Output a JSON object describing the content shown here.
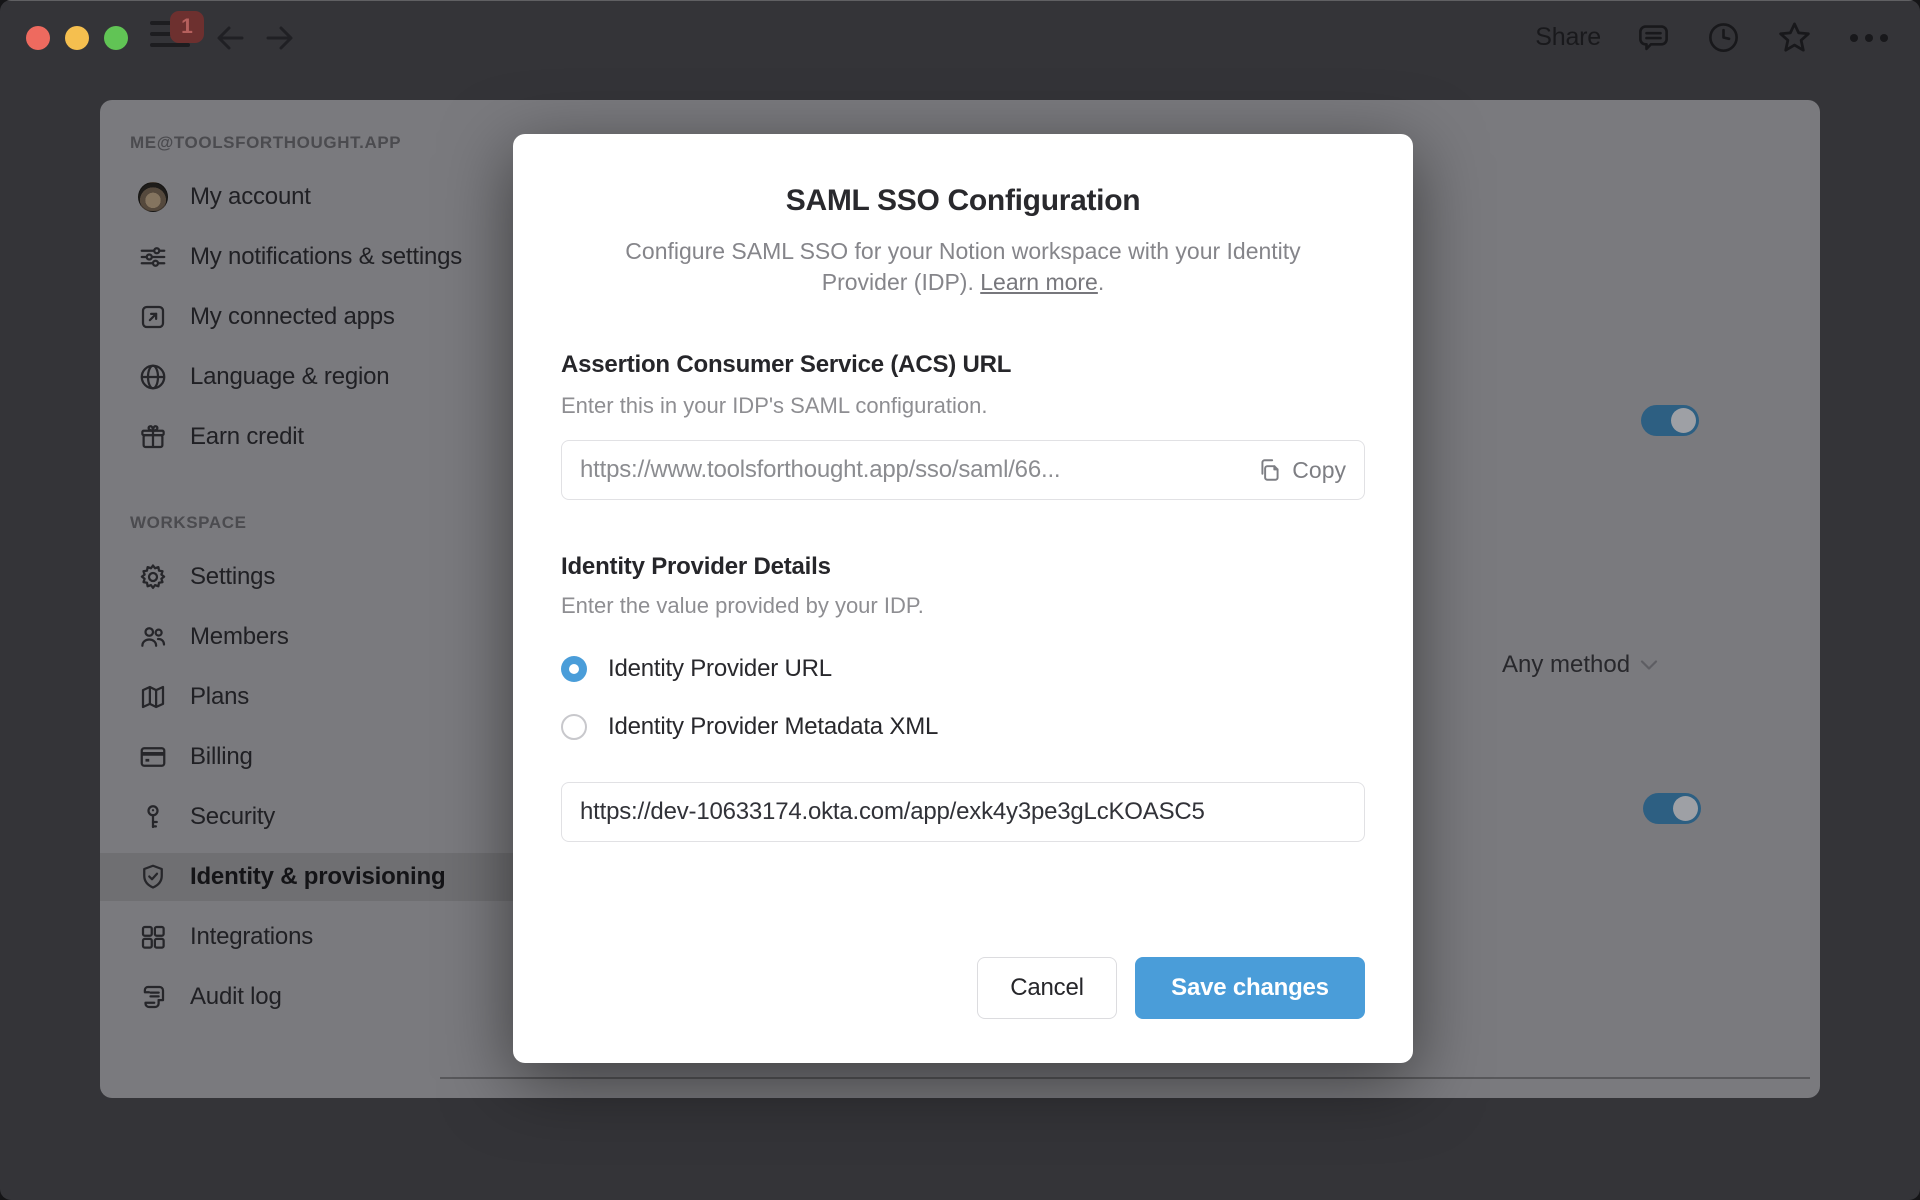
{
  "topbar": {
    "badge_count": "1",
    "share_label": "Share"
  },
  "sidebar": {
    "account_header": "ME@TOOLSFORTHOUGHT.APP",
    "account_items": [
      {
        "label": "My account",
        "icon": "avatar"
      },
      {
        "label": "My notifications & settings",
        "icon": "sliders-icon"
      },
      {
        "label": "My connected apps",
        "icon": "external-link-icon"
      },
      {
        "label": "Language & region",
        "icon": "globe-icon"
      },
      {
        "label": "Earn credit",
        "icon": "gift-icon"
      }
    ],
    "workspace_header": "WORKSPACE",
    "workspace_items": [
      {
        "label": "Settings",
        "icon": "gear-icon",
        "selected": false
      },
      {
        "label": "Members",
        "icon": "members-icon",
        "selected": false
      },
      {
        "label": "Plans",
        "icon": "map-icon",
        "selected": false
      },
      {
        "label": "Billing",
        "icon": "credit-card-icon",
        "selected": false
      },
      {
        "label": "Security",
        "icon": "key-icon",
        "selected": false
      },
      {
        "label": "Identity & provisioning",
        "icon": "shield-check-icon",
        "selected": true
      },
      {
        "label": "Integrations",
        "icon": "grid-icon",
        "selected": false
      },
      {
        "label": "Audit log",
        "icon": "audit-log-icon",
        "selected": false
      }
    ]
  },
  "content": {
    "any_method_label": "Any method",
    "toggle_top_state": "on",
    "toggle_bottom_state": "on"
  },
  "modal": {
    "title": "SAML SSO Configuration",
    "subtitle_text": "Configure SAML SSO for your Notion workspace with your Identity Provider (IDP). ",
    "learn_more_label": "Learn more",
    "subtitle_suffix": ".",
    "acs": {
      "heading": "Assertion Consumer Service (ACS) URL",
      "helper": "Enter this in your IDP's SAML configuration.",
      "value": "https://www.toolsforthought.app/sso/saml/66...",
      "copy_label": "Copy"
    },
    "idp": {
      "heading": "Identity Provider Details",
      "helper": "Enter the value provided by your IDP.",
      "options": [
        {
          "label": "Identity Provider URL",
          "selected": true
        },
        {
          "label": "Identity Provider Metadata XML",
          "selected": false
        }
      ],
      "value": "https://dev-10633174.okta.com/app/exk4y3pe3gLcKOASC5"
    },
    "cancel_label": "Cancel",
    "save_label": "Save changes"
  },
  "colors": {
    "accent_blue": "#4a9dd9",
    "toggle_blue": "#2d5f82",
    "badge_red": "#6d302f",
    "traffic_red": "#ee6a5f",
    "traffic_yellow": "#f5bf4f",
    "traffic_green": "#61c455"
  }
}
